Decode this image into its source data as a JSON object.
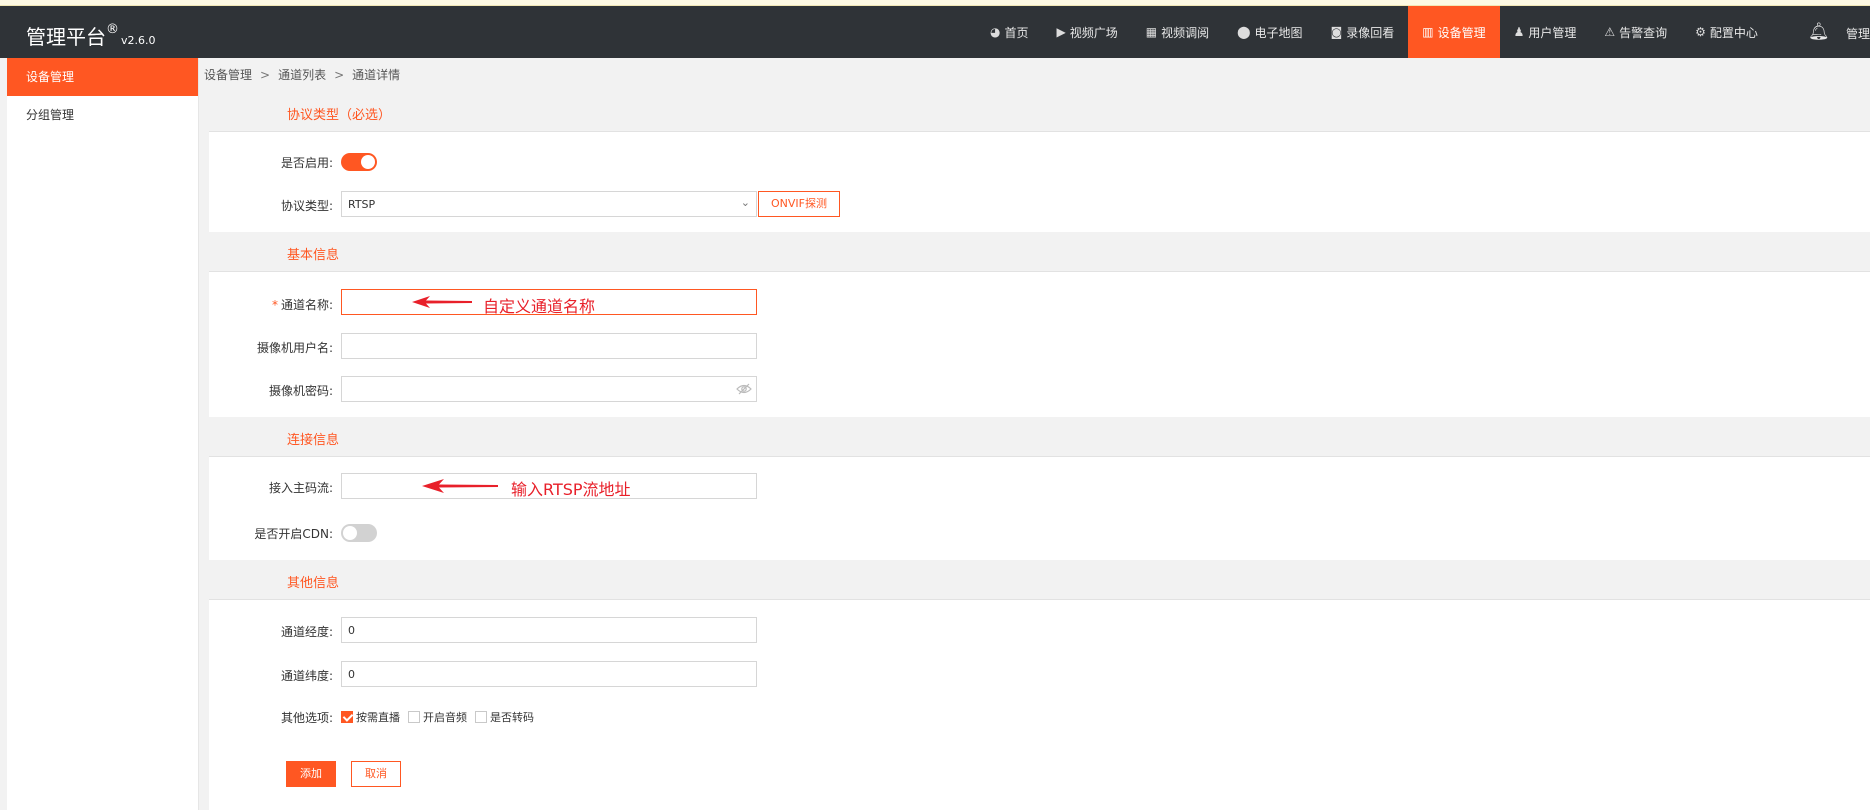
{
  "header": {
    "brand": "管理平台",
    "brand_mark": "®",
    "version": "v2.6.0",
    "nav": [
      {
        "label": "首页",
        "icon": "dashboard-icon",
        "glyph": "◕"
      },
      {
        "label": "视频广场",
        "icon": "play-circle-icon",
        "glyph": "▶"
      },
      {
        "label": "视频调阅",
        "icon": "table-icon",
        "glyph": "▦"
      },
      {
        "label": "电子地图",
        "icon": "map-marker-icon",
        "glyph": "⬤"
      },
      {
        "label": "录像回看",
        "icon": "video-camera-icon",
        "glyph": "◙"
      },
      {
        "label": "设备管理",
        "icon": "device-icon",
        "glyph": "▥",
        "active": true
      },
      {
        "label": "用户管理",
        "icon": "user-icon",
        "glyph": "♟"
      },
      {
        "label": "告警查询",
        "icon": "alarm-icon",
        "glyph": "⚠"
      },
      {
        "label": "配置中心",
        "icon": "gear-icon",
        "glyph": "⚙"
      }
    ],
    "user_label": "管理"
  },
  "sidebar": {
    "items": [
      {
        "label": "设备管理",
        "active": true
      },
      {
        "label": "分组管理",
        "active": false
      }
    ]
  },
  "breadcrumb": [
    "设备管理",
    "通道列表",
    "通道详情"
  ],
  "breadcrumb_sep": ">",
  "form": {
    "protocol_section": {
      "title": "协议类型（必选）",
      "enable_label": "是否启用:",
      "enable_on": true,
      "protocol_label": "协议类型:",
      "protocol_value": "RTSP",
      "onvif_button": "ONVIF探测"
    },
    "basic_section": {
      "title": "基本信息",
      "required_mark": "*",
      "channel_name_label": "通道名称:",
      "channel_name_value": "",
      "username_label": "摄像机用户名:",
      "username_value": "",
      "password_label": "摄像机密码:",
      "password_value": ""
    },
    "connection_section": {
      "title": "连接信息",
      "main_stream_label": "接入主码流:",
      "main_stream_value": "",
      "cdn_label": "是否开启CDN:",
      "cdn_on": false
    },
    "other_section": {
      "title": "其他信息",
      "longitude_label": "通道经度:",
      "longitude_value": "0",
      "latitude_label": "通道纬度:",
      "latitude_value": "0",
      "options_label": "其他选项:",
      "options": [
        {
          "label": "按需直播",
          "checked": true
        },
        {
          "label": "开启音频",
          "checked": false
        },
        {
          "label": "是否转码",
          "checked": false
        }
      ]
    },
    "add_button": "添加",
    "cancel_button": "取消"
  },
  "annotations": {
    "channel_name_hint": "自定义通道名称",
    "rtsp_hint": "输入RTSP流地址"
  },
  "colors": {
    "accent": "#ff5722",
    "header_bg": "#2f3337",
    "annotation": "#e8202a"
  }
}
